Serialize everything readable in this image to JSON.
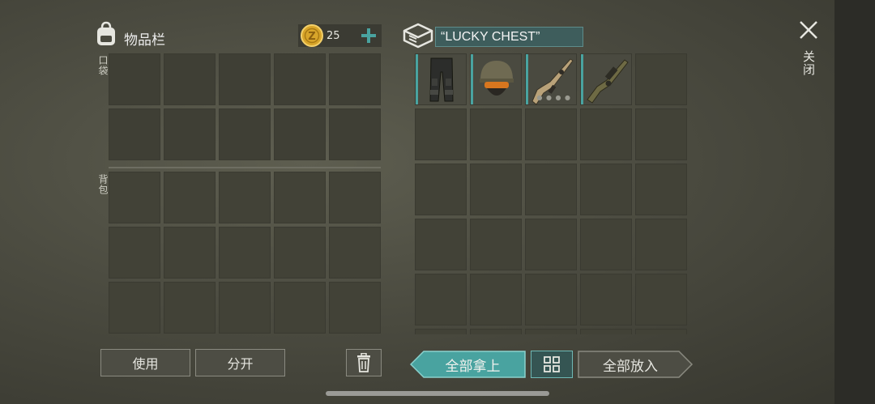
{
  "inventory": {
    "title": "物品栏",
    "coins": "25",
    "pocket_label": "口袋",
    "backpack_label": "背包",
    "use_label": "使用",
    "split_label": "分开"
  },
  "chest": {
    "name": "“LUCKY CHEST”",
    "items": [
      "tactical-pants",
      "military-helmet",
      "assault-rifle",
      "grenade-launcher"
    ],
    "take_all_label": "全部拿上",
    "put_all_label": "全部放入"
  },
  "close_label": "关闭",
  "colors": {
    "accent_teal": "#49a3a0",
    "coin_gold": "#d8a52a"
  }
}
